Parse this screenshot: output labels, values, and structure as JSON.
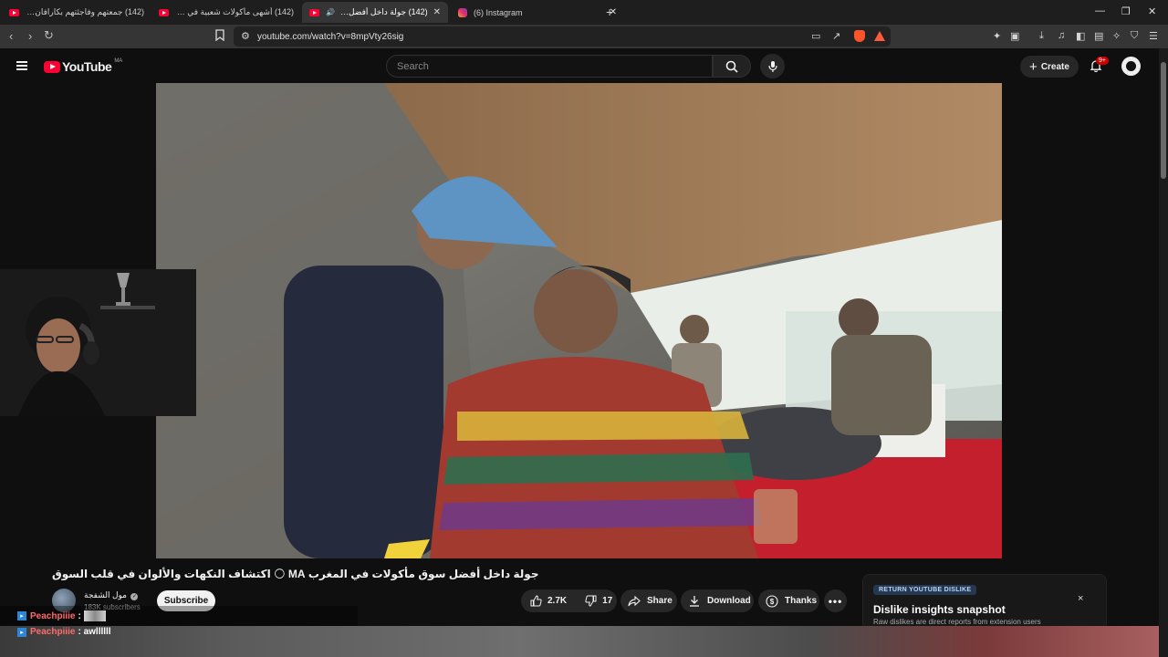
{
  "browser": {
    "tabs": [
      {
        "title": "(142) جمعتهم وفاجئتهم بكارافان بمناسبة"
      },
      {
        "title": "(142) أشهى مأكولات شعبية في م..."
      },
      {
        "title": "(142) جولة داخل أفضل سوق مأ..."
      },
      {
        "title": "(6) Instagram"
      }
    ],
    "new_tab": "+",
    "url": "youtube.com/watch?v=8mpVty26sig"
  },
  "youtube": {
    "logo_text": "YouTube",
    "country_code": "MA",
    "search_placeholder": "Search",
    "create_label": "Create",
    "notification_count": "9+"
  },
  "video": {
    "title": "جولة داخل أفضل سوق مأكولات في المغرب MA 🌕 اكتشاف النكهات والألوان في قلب السوق"
  },
  "channel": {
    "name": "مول الشفجة",
    "subscribers": "183K subscribers",
    "subscribe_label": "Subscribe"
  },
  "actions": {
    "likes": "2.7K",
    "dislikes": "17",
    "share_label": "Share",
    "download_label": "Download",
    "thanks_label": "Thanks",
    "more_label": "•••"
  },
  "dislike_card": {
    "tag": "RETURN YOUTUBE DISLIKE",
    "heading": "Dislike insights snapshot",
    "subtext": "Raw dislikes are direct reports from extension users",
    "close": "×"
  },
  "chat": [
    {
      "user": "Peachpiiie",
      "message": ""
    },
    {
      "user": "Peachpiiie",
      "message": ": awllllll"
    }
  ],
  "colors": {
    "youtube_red": "#ff0033",
    "background": "#0f0f0f",
    "pill": "#272727",
    "chat_user": "#ff6b6b"
  }
}
